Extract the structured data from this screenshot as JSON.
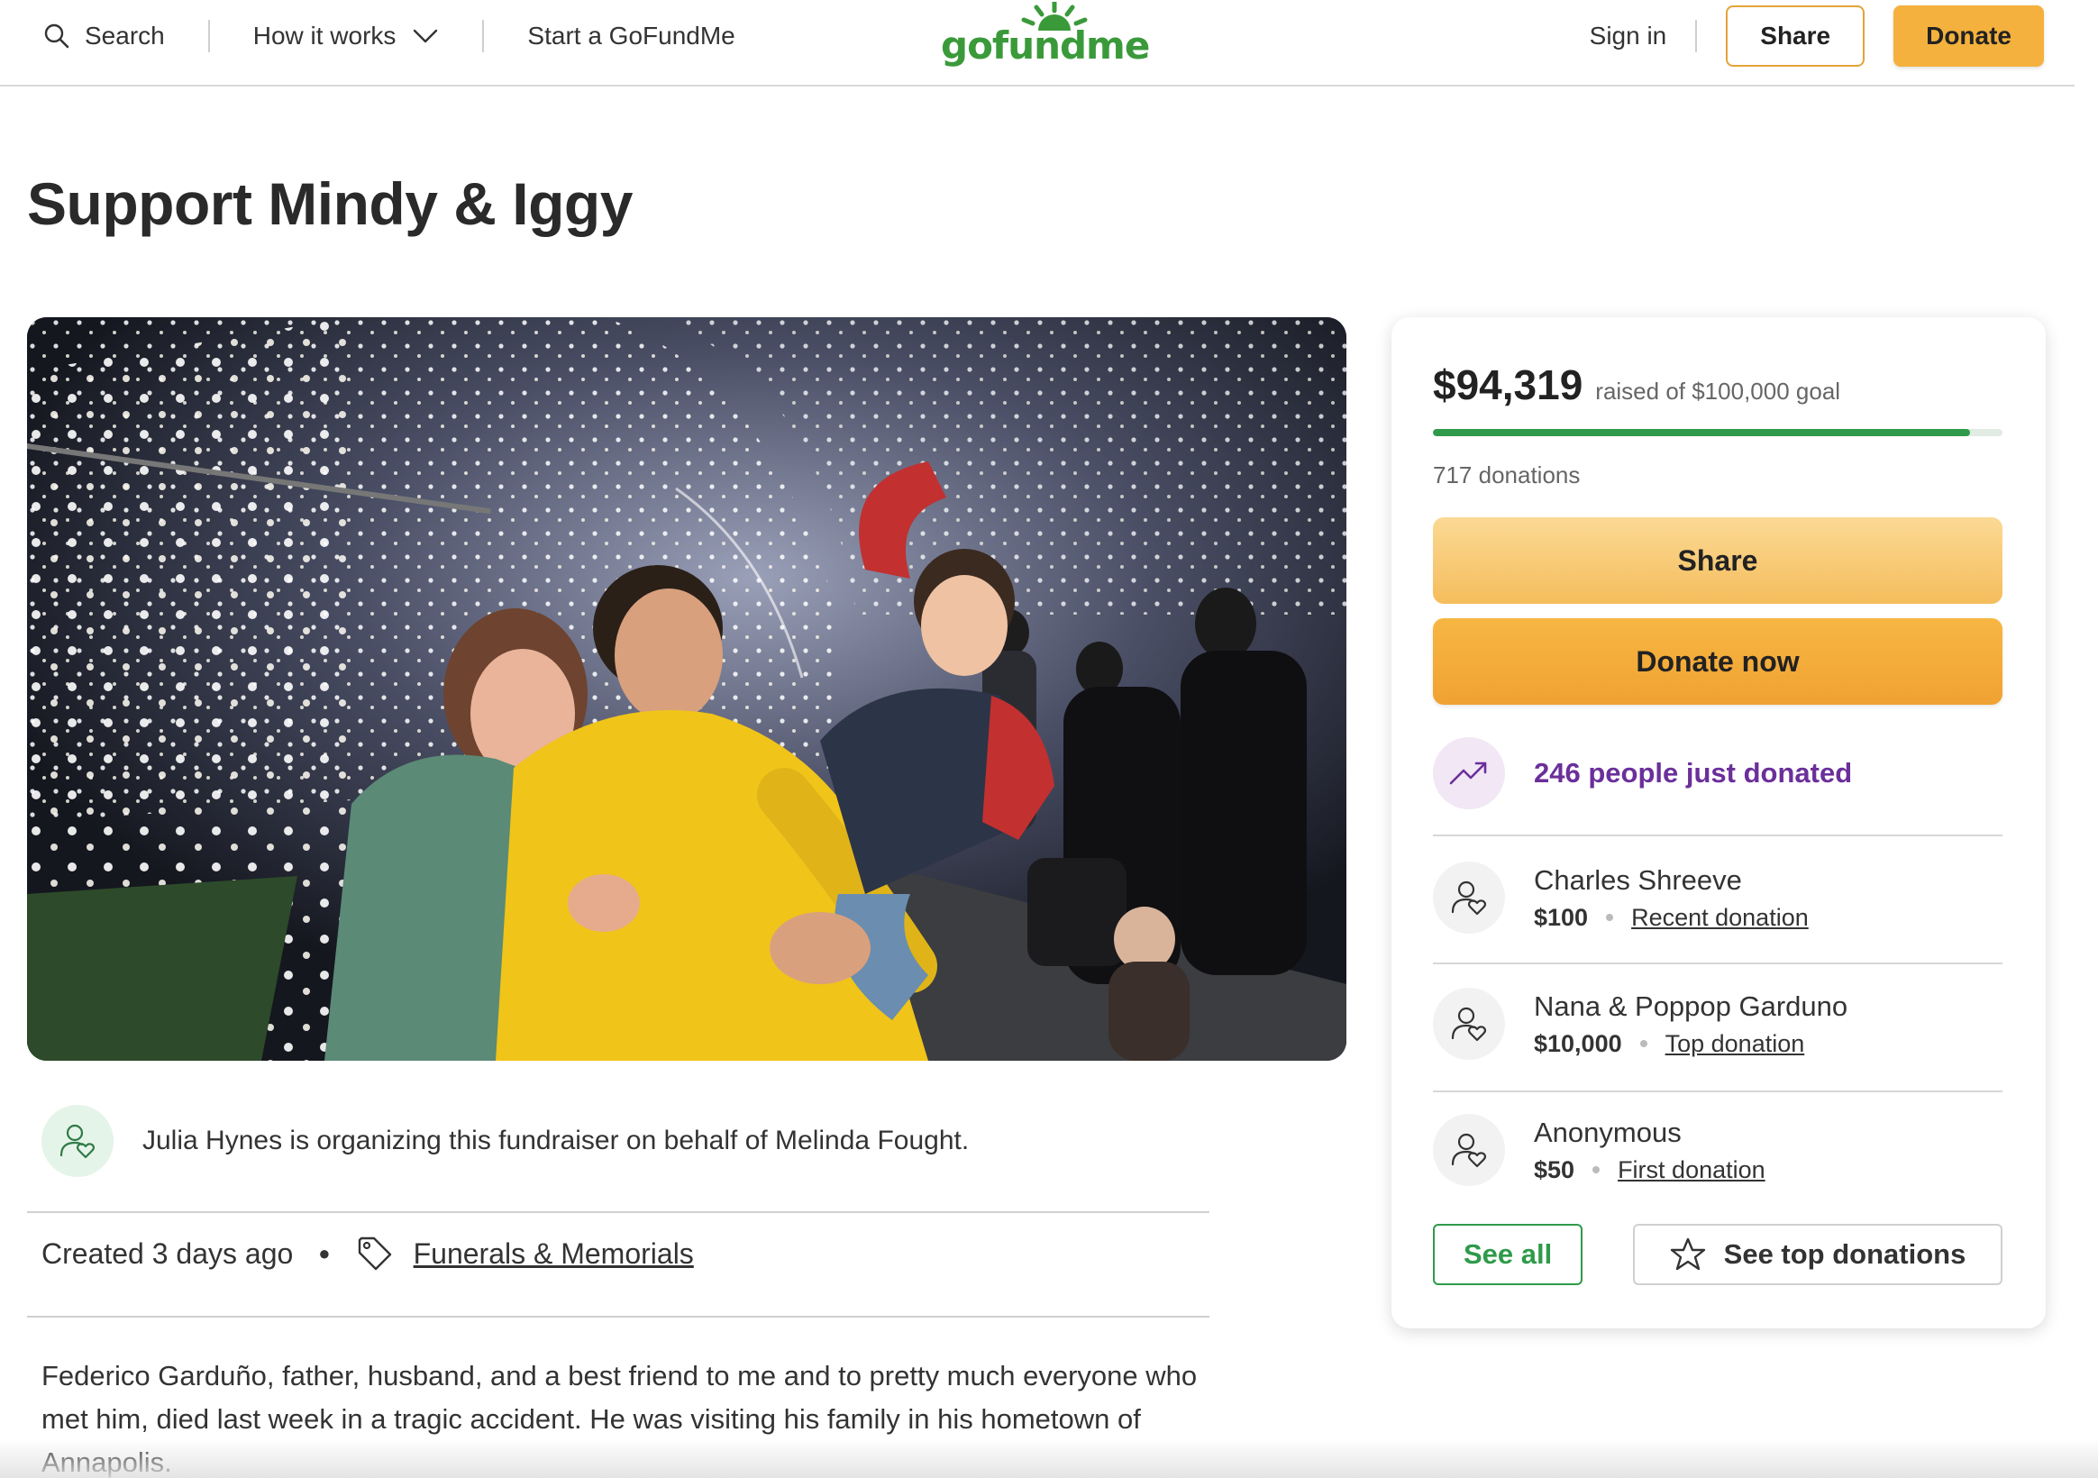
{
  "header": {
    "search_label": "Search",
    "how_it_works_label": "How it works",
    "start_label": "Start a GoFundMe",
    "logo_text": "gofundme",
    "signin_label": "Sign in",
    "share_label": "Share",
    "donate_label": "Donate",
    "icons": [
      "search-icon",
      "chevron-down-icon",
      "gofundme-logo"
    ]
  },
  "page": {
    "title": "Support Mindy & Iggy"
  },
  "organizer": {
    "text": "Julia Hynes is organizing this fundraiser on behalf of Melinda Fought.",
    "created": "Created 3 days ago",
    "category": "Funerals & Memorials"
  },
  "story": {
    "text": "Federico Garduño, father, husband, and a best friend to me and to pretty much everyone who met him, died last week in a tragic accident. He was visiting his family in his hometown of Annapolis."
  },
  "donation_card": {
    "raised": "$94,319",
    "goal_text": "raised of $100,000 goal",
    "progress_fraction": 0.943,
    "donation_count": "717 donations",
    "share_label": "Share",
    "donate_now_label": "Donate now",
    "trend_text": "246 people just donated",
    "donors": [
      {
        "name": "Charles Shreeve",
        "amount": "$100",
        "tag": "Recent donation"
      },
      {
        "name": "Nana & Poppop Garduno",
        "amount": "$10,000",
        "tag": "Top donation"
      },
      {
        "name": "Anonymous",
        "amount": "$50",
        "tag": "First donation"
      }
    ],
    "see_all_label": "See all",
    "see_top_label": "See top donations"
  },
  "colors": {
    "brand_green": "#3a9a3a",
    "accent_orange": "#f4b13d",
    "trend_purple": "#6b2f9a",
    "progress_green": "#2f9a4a"
  }
}
